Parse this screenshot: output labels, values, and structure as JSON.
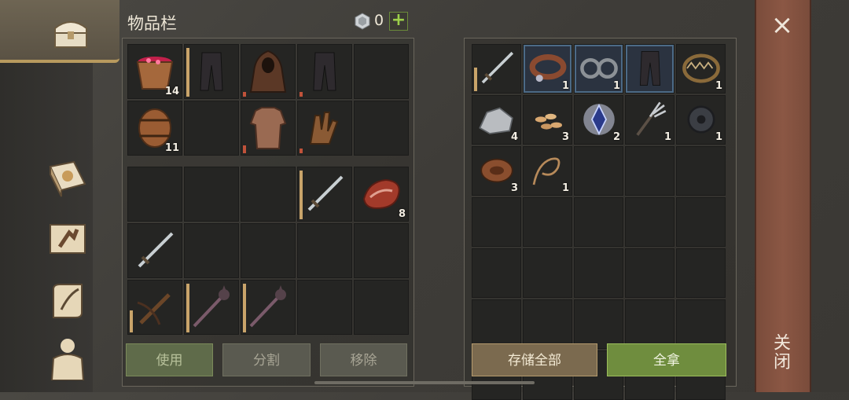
{
  "inventory": {
    "title": "物品栏",
    "gem_count": "0",
    "add_label": "+",
    "equip_grid": [
      {
        "icon": "berry-bucket-icon",
        "count": "14"
      },
      {
        "icon": "dark-pants-icon",
        "count": ""
      },
      {
        "icon": "hood-cloak-icon",
        "count": ""
      },
      {
        "icon": "dark-pants-icon",
        "count": ""
      },
      {
        "icon": "",
        "count": ""
      },
      {
        "icon": "wooden-barrel-icon",
        "count": "11"
      },
      {
        "icon": "",
        "count": ""
      },
      {
        "icon": "chainmail-icon",
        "count": ""
      },
      {
        "icon": "leather-gloves-icon",
        "count": ""
      },
      {
        "icon": "",
        "count": ""
      }
    ],
    "bag_grid": [
      {
        "icon": "",
        "count": ""
      },
      {
        "icon": "",
        "count": ""
      },
      {
        "icon": "",
        "count": ""
      },
      {
        "icon": "sword-icon",
        "count": ""
      },
      {
        "icon": "raw-meat-icon",
        "count": "8"
      },
      {
        "icon": "sword-icon",
        "count": ""
      },
      {
        "icon": "",
        "count": ""
      },
      {
        "icon": "",
        "count": ""
      },
      {
        "icon": "",
        "count": ""
      },
      {
        "icon": "",
        "count": ""
      },
      {
        "icon": "crossbow-icon",
        "count": ""
      },
      {
        "icon": "mace-icon",
        "count": ""
      },
      {
        "icon": "mace-icon",
        "count": ""
      },
      {
        "icon": "",
        "count": ""
      },
      {
        "icon": "",
        "count": ""
      }
    ],
    "buttons": {
      "use": "使用",
      "split": "分割",
      "remove": "移除"
    }
  },
  "storage": {
    "grid": [
      {
        "icon": "sword-icon",
        "count": ""
      },
      {
        "icon": "leather-collar-icon",
        "count": "1"
      },
      {
        "icon": "iron-shackles-icon",
        "count": "1"
      },
      {
        "icon": "dark-pants-icon",
        "count": ""
      },
      {
        "icon": "bear-trap-icon",
        "count": "1"
      },
      {
        "icon": "stone-ore-icon",
        "count": "4"
      },
      {
        "icon": "seeds-icon",
        "count": "3"
      },
      {
        "icon": "crystal-shard-icon",
        "count": "2"
      },
      {
        "icon": "pitchfork-icon",
        "count": "1"
      },
      {
        "icon": "gear-part-icon",
        "count": "1"
      },
      {
        "icon": "leather-roll-icon",
        "count": "3"
      },
      {
        "icon": "rope-icon",
        "count": "1"
      }
    ],
    "buttons": {
      "store_all": "存储全部",
      "take_all": "全拿"
    }
  },
  "close": {
    "x": "×",
    "label": "关闭"
  },
  "nav": [
    {
      "icon": "chest-icon"
    },
    {
      "icon": "sun-book-icon"
    },
    {
      "icon": "map-icon"
    },
    {
      "icon": "scroll-quill-icon"
    },
    {
      "icon": "character-icon"
    }
  ],
  "colors": {
    "take_all": "#6f8d3e",
    "store_all": "#7b6a4f",
    "close_bar": "#8b5744",
    "durability": "#c9a46a"
  }
}
